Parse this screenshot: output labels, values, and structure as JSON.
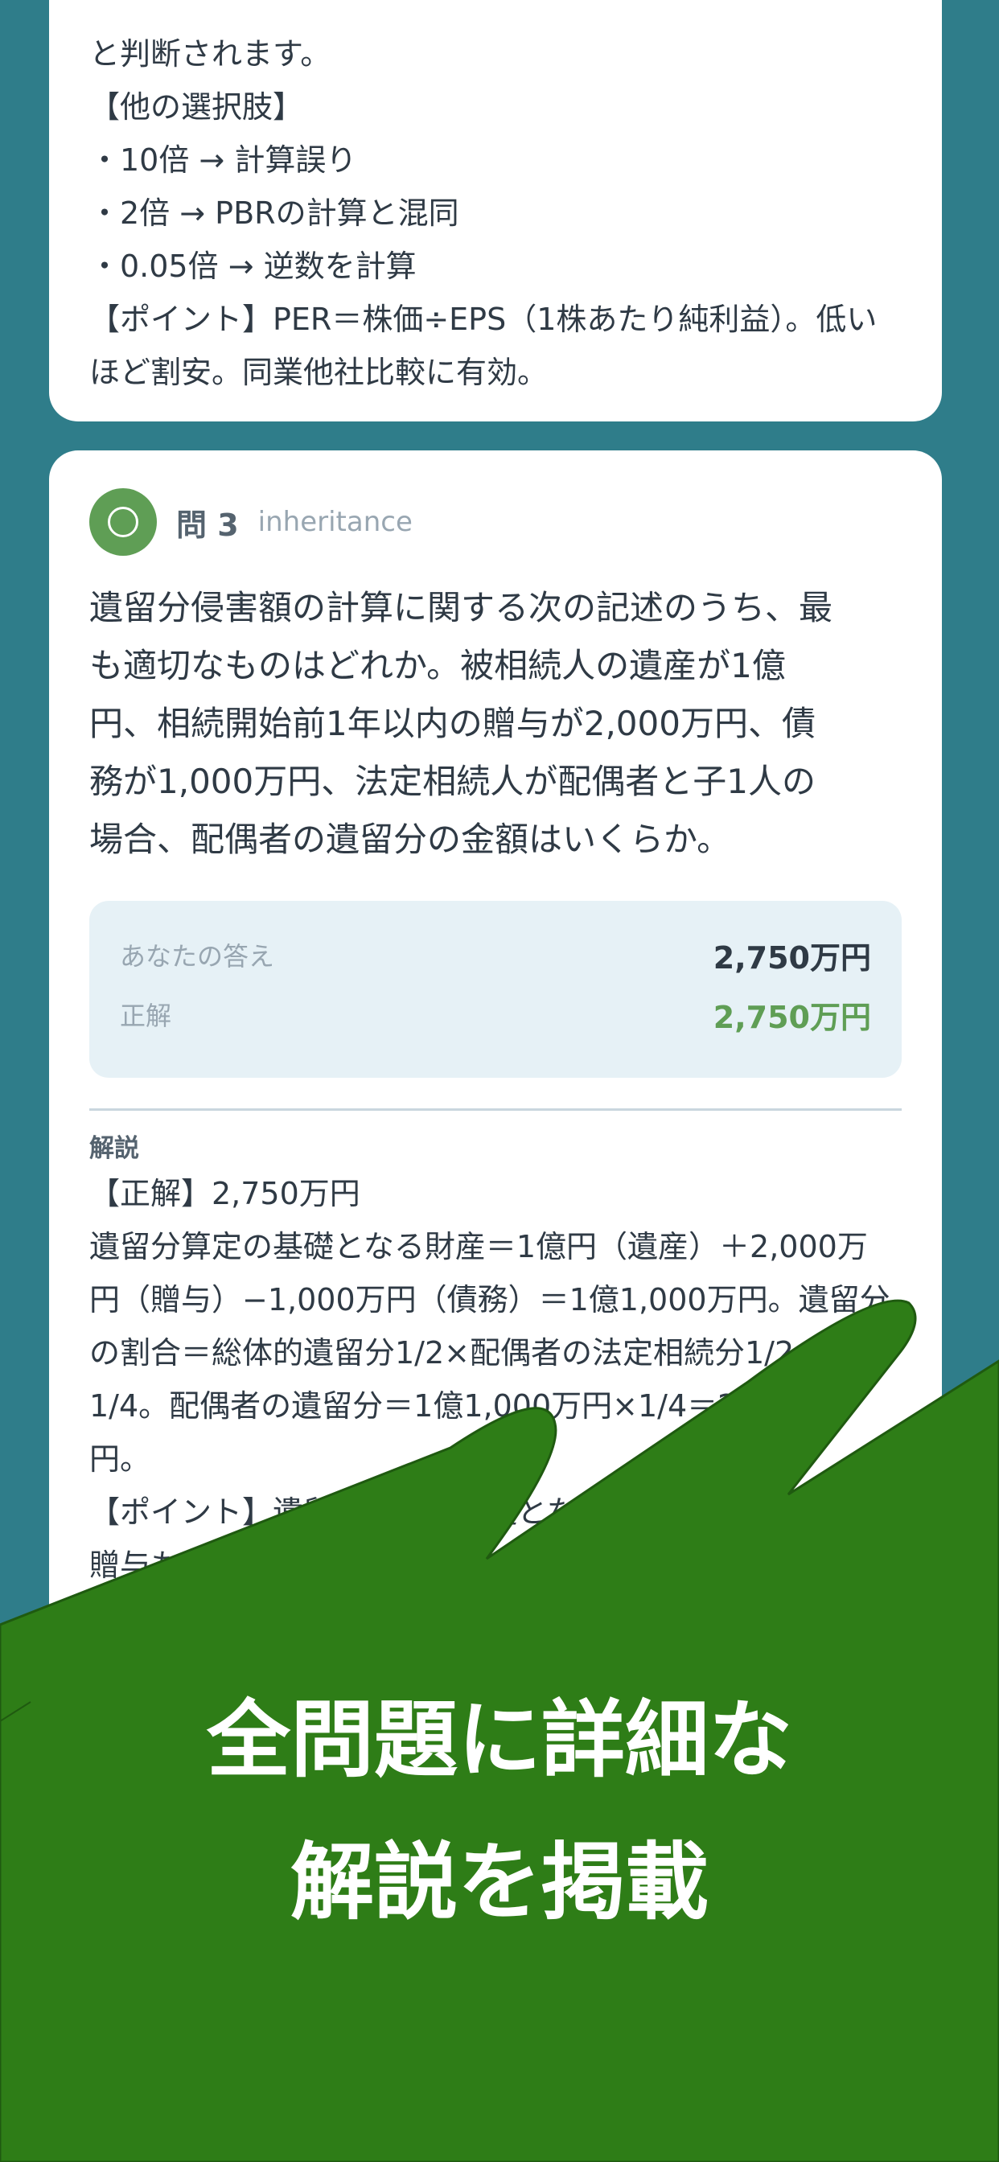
{
  "prev_card": {
    "lines": [
      "と判断されます。",
      "【他の選択肢】",
      "・10倍 → 計算誤り",
      "・2倍 → PBRの計算と混同",
      "・0.05倍 → 逆数を計算",
      "【ポイント】PER＝株価÷EPS（1株あたり純利益）。低い",
      "ほど割安。同業他社比較に有効。"
    ]
  },
  "question": {
    "number": "問 3",
    "category": "inheritance",
    "result_icon": "correct-circle-icon",
    "text_lines": [
      "遺留分侵害額の計算に関する次の記述のうち、最",
      "も適切なものはどれか。被相続人の遺産が1億",
      "円、相続開始前1年以内の贈与が2,000万円、債",
      "務が1,000万円、法定相続人が配偶者と子1人の",
      "場合、配偶者の遺留分の金額はいくらか。"
    ],
    "your_answer_label": "あなたの答え",
    "your_answer": "2,750万円",
    "correct_label": "正解",
    "correct_answer": "2,750万円",
    "explanation_heading": "解説",
    "explanation_lines": [
      "【正解】2,750万円",
      "遺留分算定の基礎となる財産＝1億円（遺産）＋2,000万",
      "円（贈与）−1,000万円（債務）＝1億1,000万円。遺留分",
      "の割合＝総体的遺留分1/2×配偶者の法定相続分1/2＝",
      "1/4。配偶者の遺留分＝1億1,000万円×1/4＝2,750万",
      "円。",
      "【ポイント】遺留分算定の基礎となる財産には",
      "贈与も含まれる。"
    ]
  },
  "promo": {
    "line1": "全問題に詳細な",
    "line2": "解説を掲載"
  },
  "colors": {
    "background": "#2f7d8a",
    "card": "#ffffff",
    "correct_green": "#5f9e55",
    "promo_green": "#2e7d17",
    "answer_box": "#e6f1f6"
  }
}
